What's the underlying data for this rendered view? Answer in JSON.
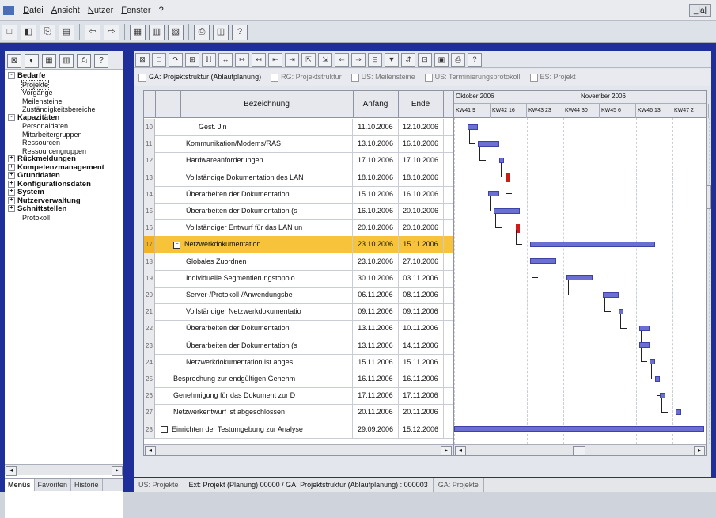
{
  "menubar": {
    "items": [
      "Datei",
      "Ansicht",
      "Nutzer",
      "Fenster",
      "?"
    ],
    "window_control": "_|a|"
  },
  "toolbar": {
    "icons": [
      "new-icon",
      "open-icon",
      "save-icon",
      "print-icon",
      "back-icon",
      "forward-icon",
      "grid-icon",
      "chart-icon",
      "calendar-icon",
      "printer-icon",
      "stop-icon",
      "help-icon"
    ],
    "glyphs": [
      "□",
      "◧",
      "⎘",
      "▤",
      "⇦",
      "⇨",
      "▦",
      "▥",
      "▧",
      "⎙",
      "◫",
      "?"
    ]
  },
  "left_tools": {
    "glyphs": [
      "⊠",
      "◐",
      "▦",
      "▥",
      "⎙",
      "?"
    ]
  },
  "tree": [
    {
      "label": "Bedarfe",
      "level": 0,
      "bold": true,
      "exp": "-"
    },
    {
      "label": "Projekte",
      "level": 1,
      "selected": true
    },
    {
      "label": "Vorgänge",
      "level": 1
    },
    {
      "label": "Meilensteine",
      "level": 1
    },
    {
      "label": "Zuständigkeitsbereiche",
      "level": 1
    },
    {
      "label": "Kapazitäten",
      "level": 0,
      "bold": true,
      "exp": "-"
    },
    {
      "label": "Personaldaten",
      "level": 1
    },
    {
      "label": "Mitarbeitergruppen",
      "level": 1
    },
    {
      "label": "Ressourcen",
      "level": 1
    },
    {
      "label": "Ressourcengruppen",
      "level": 1
    },
    {
      "label": "Rückmeldungen",
      "level": 0,
      "bold": true,
      "exp": "+"
    },
    {
      "label": "Kompetenzmanagement",
      "level": 0,
      "bold": true,
      "exp": "+"
    },
    {
      "label": "Grunddaten",
      "level": 0,
      "bold": true,
      "exp": "+"
    },
    {
      "label": "Konfigurationsdaten",
      "level": 0,
      "bold": true,
      "exp": "+"
    },
    {
      "label": "System",
      "level": 0,
      "bold": true,
      "exp": "+"
    },
    {
      "label": "Nutzerverwaltung",
      "level": 0,
      "bold": true,
      "exp": "+"
    },
    {
      "label": "Schnittstellen",
      "level": 0,
      "bold": true,
      "exp": "+"
    },
    {
      "label": "Protokoll",
      "level": 1
    }
  ],
  "left_tabs": [
    "Menüs",
    "Favoriten",
    "Historie"
  ],
  "gantt_toolbar": {
    "glyphs": [
      "⊠",
      "□",
      "↷",
      "⊞",
      "ℍ",
      "↔",
      "↦",
      "↤",
      "⇤",
      "⇥",
      "⇱",
      "⇲",
      "⇐",
      "⇒",
      "⊟",
      "▼",
      "⇵",
      "⊡",
      "▣",
      "⎙",
      "?"
    ]
  },
  "doc_tabs": [
    {
      "label": "GA: Projektstruktur (Ablaufplanung)",
      "active": true
    },
    {
      "label": "RG: Projektstruktur",
      "active": false
    },
    {
      "label": "US: Meilensteine",
      "active": false
    },
    {
      "label": "US: Terminierungsprotokoll",
      "active": false
    },
    {
      "label": "ES: Projekt",
      "active": false
    }
  ],
  "grid": {
    "headers": {
      "name": "Bezeichnung",
      "start": "Anfang",
      "end": "Ende"
    },
    "rows": [
      {
        "num": "10",
        "name": "Gest. Jin",
        "start": "11.10.2006",
        "end": "12.10.2006",
        "indent": 3
      },
      {
        "num": "11",
        "name": "Kommunikation/Modems/RAS",
        "start": "13.10.2006",
        "end": "16.10.2006",
        "indent": 2
      },
      {
        "num": "12",
        "name": "Hardwareanforderungen",
        "start": "17.10.2006",
        "end": "17.10.2006",
        "indent": 2
      },
      {
        "num": "13",
        "name": "Vollständige Dokumentation des LAN",
        "start": "18.10.2006",
        "end": "18.10.2006",
        "indent": 2
      },
      {
        "num": "14",
        "name": "Überarbeiten der Dokumentation",
        "start": "15.10.2006",
        "end": "16.10.2006",
        "indent": 2
      },
      {
        "num": "15",
        "name": "Überarbeiten der Dokumentation (s",
        "start": "16.10.2006",
        "end": "20.10.2006",
        "indent": 2
      },
      {
        "num": "16",
        "name": "Vollständiger Entwurf für das LAN un",
        "start": "20.10.2006",
        "end": "20.10.2006",
        "indent": 2
      },
      {
        "num": "17",
        "name": "Netzwerkdokumentation",
        "start": "23.10.2006",
        "end": "15.11.2006",
        "indent": 1,
        "highlight": true,
        "collapsible": true
      },
      {
        "num": "18",
        "name": "Globales Zuordnen",
        "start": "23.10.2006",
        "end": "27.10.2006",
        "indent": 2
      },
      {
        "num": "19",
        "name": "Individuelle Segmentierungstopolo",
        "start": "30.10.2006",
        "end": "03.11.2006",
        "indent": 2
      },
      {
        "num": "20",
        "name": "Server-/Protokoll-/Anwendungsbe",
        "start": "06.11.2006",
        "end": "08.11.2006",
        "indent": 2
      },
      {
        "num": "21",
        "name": "Vollständiger Netzwerkdokumentatio",
        "start": "09.11.2006",
        "end": "09.11.2006",
        "indent": 2
      },
      {
        "num": "22",
        "name": "Überarbeiten der Dokumentation",
        "start": "13.11.2006",
        "end": "10.11.2006",
        "indent": 2
      },
      {
        "num": "23",
        "name": "Überarbeiten der Dokumentation (s",
        "start": "13.11.2006",
        "end": "14.11.2006",
        "indent": 2
      },
      {
        "num": "24",
        "name": "Netzwerkdokumentation ist abges",
        "start": "15.11.2006",
        "end": "15.11.2006",
        "indent": 2
      },
      {
        "num": "25",
        "name": "Besprechung zur endgültigen Genehm",
        "start": "16.11.2006",
        "end": "16.11.2006",
        "indent": 1
      },
      {
        "num": "26",
        "name": "Genehmigung für das Dokument zur D",
        "start": "17.11.2006",
        "end": "17.11.2006",
        "indent": 1
      },
      {
        "num": "27",
        "name": "Netzwerkentwurf ist abgeschlossen",
        "start": "20.11.2006",
        "end": "20.11.2006",
        "indent": 1
      },
      {
        "num": "28",
        "name": "Einrichten der Testumgebung zur Analyse",
        "start": "29.09.2006",
        "end": "15.12.2006",
        "indent": 0,
        "collapsible": true
      }
    ]
  },
  "gantt": {
    "months": [
      "Oktober 2006",
      "November 2006"
    ],
    "weeks": [
      "KW41 9",
      "KW42 16",
      "KW43 23",
      "KW44 30",
      "KW45 6",
      "KW46 13",
      "KW47 2"
    ],
    "tasks": [
      {
        "type": "bar",
        "start": "11.10.2006",
        "end": "12.10.2006"
      },
      {
        "type": "bar",
        "start": "13.10.2006",
        "end": "16.10.2006"
      },
      {
        "type": "bar",
        "start": "17.10.2006",
        "end": "17.10.2006"
      },
      {
        "type": "milestone",
        "start": "18.10.2006",
        "end": "18.10.2006"
      },
      {
        "type": "bar",
        "start": "15.10.2006",
        "end": "16.10.2006"
      },
      {
        "type": "bar",
        "start": "16.10.2006",
        "end": "20.10.2006"
      },
      {
        "type": "milestone",
        "start": "20.10.2006",
        "end": "20.10.2006"
      },
      {
        "type": "bar",
        "start": "23.10.2006",
        "end": "15.11.2006"
      },
      {
        "type": "bar",
        "start": "23.10.2006",
        "end": "27.10.2006"
      },
      {
        "type": "bar",
        "start": "30.10.2006",
        "end": "03.11.2006"
      },
      {
        "type": "bar",
        "start": "06.11.2006",
        "end": "08.11.2006"
      },
      {
        "type": "bar",
        "start": "09.11.2006",
        "end": "09.11.2006"
      },
      {
        "type": "bar",
        "start": "13.11.2006",
        "end": "14.11.2006"
      },
      {
        "type": "bar",
        "start": "13.11.2006",
        "end": "14.11.2006"
      },
      {
        "type": "bar",
        "start": "15.11.2006",
        "end": "15.11.2006"
      },
      {
        "type": "bar",
        "start": "16.11.2006",
        "end": "16.11.2006"
      },
      {
        "type": "bar",
        "start": "17.11.2006",
        "end": "17.11.2006"
      },
      {
        "type": "bar",
        "start": "20.11.2006",
        "end": "20.11.2006"
      },
      {
        "type": "bar",
        "start": "29.09.2006",
        "end": "15.12.2006"
      }
    ],
    "bar_color": "#6a6fd1",
    "milestone_color": "#d11a1a"
  },
  "statusbar": {
    "items": [
      "US: Projekte",
      "Ext: Projekt (Planung) 00000 / GA: Projektstruktur (Ablaufplanung) : 000003",
      "GA: Projekte"
    ]
  },
  "colors": {
    "frame": "#1f2f9a",
    "highlight_row": "#f6c33a"
  }
}
